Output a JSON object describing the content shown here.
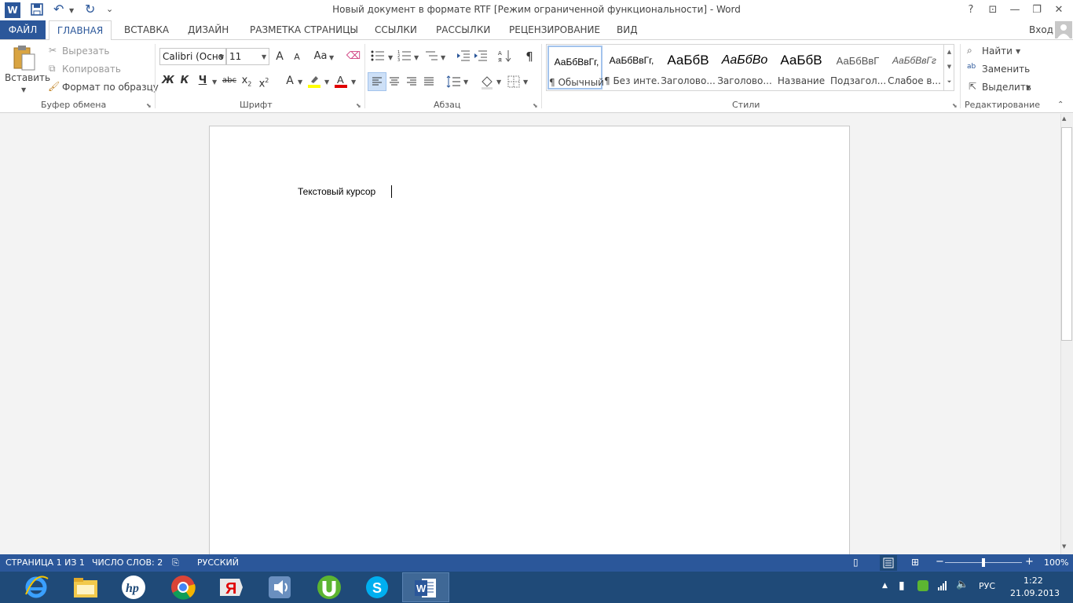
{
  "window": {
    "title": "Новый документ в формате RTF [Режим ограниченной функциональности] - Word",
    "help": "?",
    "restore_ribbon": "⊡",
    "minimize": "—",
    "maximize": "❐",
    "close": "✕"
  },
  "quick_access": {
    "undo": "↶",
    "redo": "↻",
    "customize": "⌄"
  },
  "tabs": {
    "file": "ФАЙЛ",
    "home": "ГЛАВНАЯ",
    "insert": "ВСТАВКА",
    "design": "ДИЗАЙН",
    "layout": "РАЗМЕТКА СТРАНИЦЫ",
    "references": "ССЫЛКИ",
    "mailings": "РАССЫЛКИ",
    "review": "РЕЦЕНЗИРОВАНИЕ",
    "view": "ВИД",
    "signin": "Вход"
  },
  "clipboard": {
    "paste": "Вставить",
    "cut": "Вырезать",
    "copy": "Копировать",
    "format_painter": "Формат по образцу",
    "label": "Буфер обмена"
  },
  "font": {
    "name": "Calibri (Осно",
    "size": "11",
    "grow": "A",
    "shrink": "A",
    "case": "Aa",
    "bold": "Ж",
    "italic": "К",
    "underline": "Ч",
    "strike": "abc",
    "subscript": "x",
    "superscript": "x",
    "label": "Шрифт"
  },
  "paragraph": {
    "label": "Абзац",
    "pilcrow": "¶"
  },
  "styles": {
    "label": "Стили",
    "items": [
      {
        "sample": "АаБбВвГг,",
        "name": "¶ Обычный"
      },
      {
        "sample": "АаБбВвГг,",
        "name": "¶ Без инте..."
      },
      {
        "sample": "АаБбВ",
        "name": "Заголово..."
      },
      {
        "sample": "АаБбВо",
        "name": "Заголово..."
      },
      {
        "sample": "АаБбВ",
        "name": "Название"
      },
      {
        "sample": "АаБбВвГ",
        "name": "Подзагол..."
      },
      {
        "sample": "АаБбВвГг",
        "name": "Слабое в..."
      }
    ]
  },
  "editing": {
    "find": "Найти",
    "replace": "Заменить",
    "select": "Выделить",
    "label": "Редактирование"
  },
  "document": {
    "text": "Текстовый курсор"
  },
  "status": {
    "page": "СТРАНИЦА 1 ИЗ 1",
    "words": "ЧИСЛО СЛОВ: 2",
    "language": "РУССКИЙ",
    "zoom": "100%",
    "zoom_minus": "−",
    "zoom_plus": "+"
  },
  "tray": {
    "language": "РУС",
    "time": "1:22",
    "date": "21.09.2013"
  },
  "colors": {
    "accent": "#2b579a",
    "taskbar": "#1f4a78",
    "highlight": "#ffff00",
    "font_color": "#e00000"
  }
}
